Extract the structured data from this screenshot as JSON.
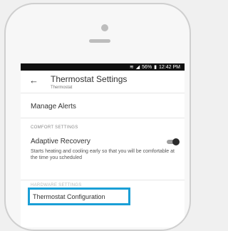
{
  "statusbar": {
    "wifi_icon": "wifi-icon",
    "signal_icon": "signal-icon",
    "battery": "56%",
    "battery_icon": "battery-icon",
    "time": "12:42 PM"
  },
  "header": {
    "back_icon": "arrow-left-icon",
    "title": "Thermostat Settings",
    "subtitle": "Thermostat"
  },
  "settings": {
    "manage_alerts": "Manage Alerts",
    "comfort_section": "COMFORT SETTINGS",
    "adaptive_recovery": {
      "label": "Adaptive Recovery",
      "enabled": true,
      "description": "Starts heating and cooling early so that you will be comfortable at the time you scheduled"
    },
    "hardware_section": "HARDWARE SETTINGS",
    "thermostat_configuration": "Thermostat Configuration"
  },
  "colors": {
    "highlight": "#1a9fd6",
    "statusbar": "#111111"
  }
}
